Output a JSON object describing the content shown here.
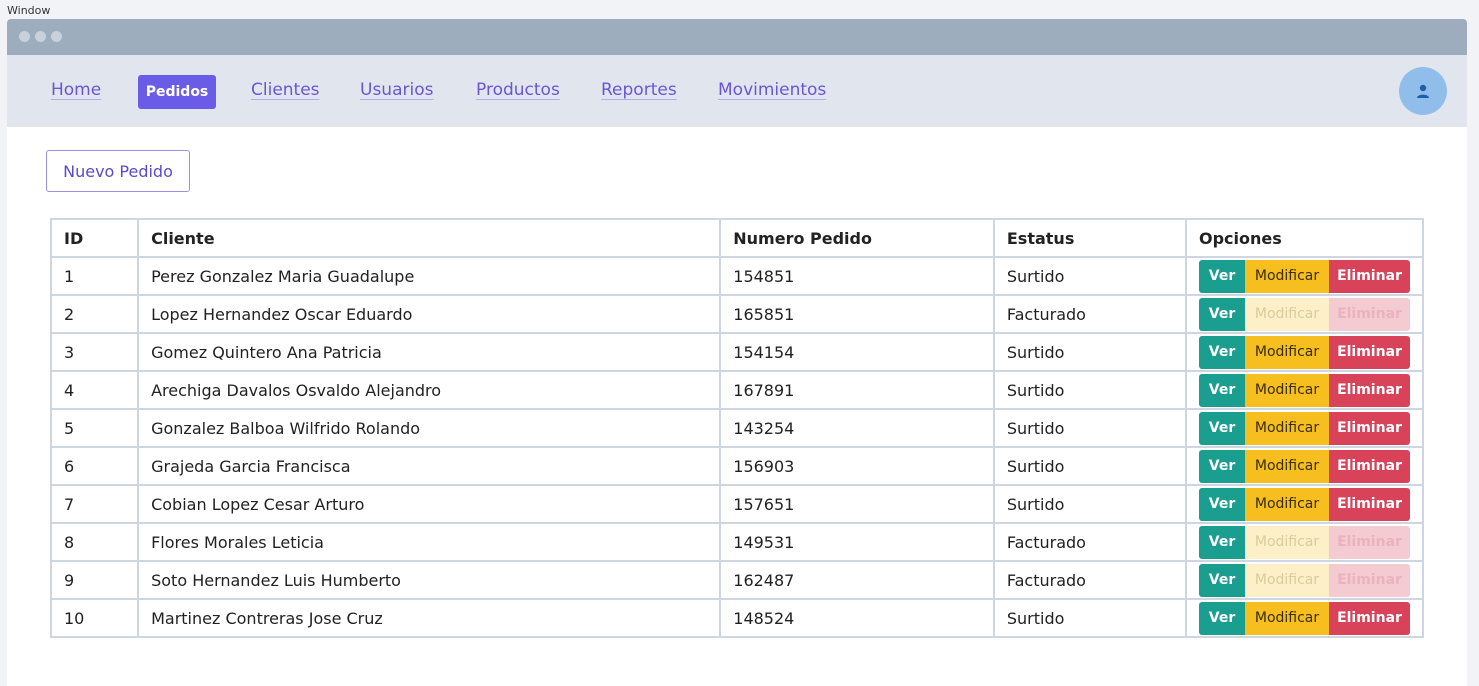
{
  "window_label": "Window",
  "nav": {
    "items": [
      {
        "label": "Home",
        "active": false
      },
      {
        "label": "Pedidos",
        "active": true
      },
      {
        "label": "Clientes",
        "active": false
      },
      {
        "label": "Usuarios",
        "active": false
      },
      {
        "label": "Productos",
        "active": false
      },
      {
        "label": "Reportes",
        "active": false
      },
      {
        "label": "Movimientos",
        "active": false
      }
    ],
    "avatar_icon": "user-icon"
  },
  "new_order_button": "Nuevo Pedido",
  "table": {
    "headers": [
      "ID",
      "Cliente",
      "Numero Pedido",
      "Estatus",
      "Opciones"
    ],
    "actions": {
      "view": "Ver",
      "edit": "Modificar",
      "delete": "Eliminar"
    },
    "rows": [
      {
        "id": "1",
        "cliente": "Perez Gonzalez Maria Guadalupe",
        "numero": "154851",
        "estatus": "Surtido",
        "enabled": true
      },
      {
        "id": "2",
        "cliente": "Lopez Hernandez Oscar Eduardo",
        "numero": "165851",
        "estatus": "Facturado",
        "enabled": false
      },
      {
        "id": "3",
        "cliente": "Gomez Quintero Ana Patricia",
        "numero": "154154",
        "estatus": "Surtido",
        "enabled": true
      },
      {
        "id": "4",
        "cliente": "Arechiga Davalos Osvaldo Alejandro",
        "numero": "167891",
        "estatus": "Surtido",
        "enabled": true
      },
      {
        "id": "5",
        "cliente": "Gonzalez Balboa Wilfrido Rolando",
        "numero": "143254",
        "estatus": "Surtido",
        "enabled": true
      },
      {
        "id": "6",
        "cliente": "Grajeda Garcia Francisca",
        "numero": "156903",
        "estatus": "Surtido",
        "enabled": true
      },
      {
        "id": "7",
        "cliente": "Cobian Lopez Cesar Arturo",
        "numero": "157651",
        "estatus": "Surtido",
        "enabled": true
      },
      {
        "id": "8",
        "cliente": "Flores Morales Leticia",
        "numero": "149531",
        "estatus": "Facturado",
        "enabled": false
      },
      {
        "id": "9",
        "cliente": "Soto Hernandez Luis Humberto",
        "numero": "162487",
        "estatus": "Facturado",
        "enabled": false
      },
      {
        "id": "10",
        "cliente": "Martinez Contreras Jose Cruz",
        "numero": "148524",
        "estatus": "Surtido",
        "enabled": true
      }
    ]
  },
  "colors": {
    "accent": "#6b5ce7",
    "ver": "#1a9e8f",
    "modificar": "#f6be1e",
    "eliminar": "#d8435a"
  }
}
